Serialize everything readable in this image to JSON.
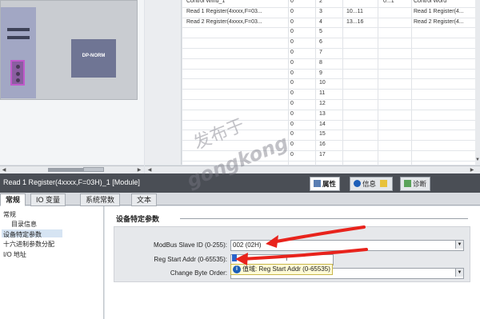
{
  "device": {
    "module_label": "DP-NORM"
  },
  "table": {
    "rows": [
      {
        "c1": "Control Wind_1",
        "c2": "0",
        "c3": "2",
        "c4": "",
        "c5": "0...1",
        "c6": "Control Word"
      },
      {
        "c1": "Read 1 Register(4xxxx,F=03...",
        "c2": "0",
        "c3": "3",
        "c4": "10...11",
        "c5": "",
        "c6": "Read 1 Register(4..."
      },
      {
        "c1": "Read 2 Register(4xxxx,F=03...",
        "c2": "0",
        "c3": "4",
        "c4": "13...16",
        "c5": "",
        "c6": "Read 2 Register(4..."
      },
      {
        "c1": "",
        "c2": "0",
        "c3": "5",
        "c4": "",
        "c5": "",
        "c6": ""
      },
      {
        "c1": "",
        "c2": "0",
        "c3": "6",
        "c4": "",
        "c5": "",
        "c6": ""
      },
      {
        "c1": "",
        "c2": "0",
        "c3": "7",
        "c4": "",
        "c5": "",
        "c6": ""
      },
      {
        "c1": "",
        "c2": "0",
        "c3": "8",
        "c4": "",
        "c5": "",
        "c6": ""
      },
      {
        "c1": "",
        "c2": "0",
        "c3": "9",
        "c4": "",
        "c5": "",
        "c6": ""
      },
      {
        "c1": "",
        "c2": "0",
        "c3": "10",
        "c4": "",
        "c5": "",
        "c6": ""
      },
      {
        "c1": "",
        "c2": "0",
        "c3": "11",
        "c4": "",
        "c5": "",
        "c6": ""
      },
      {
        "c1": "",
        "c2": "0",
        "c3": "12",
        "c4": "",
        "c5": "",
        "c6": ""
      },
      {
        "c1": "",
        "c2": "0",
        "c3": "13",
        "c4": "",
        "c5": "",
        "c6": ""
      },
      {
        "c1": "",
        "c2": "0",
        "c3": "14",
        "c4": "",
        "c5": "",
        "c6": ""
      },
      {
        "c1": "",
        "c2": "0",
        "c3": "15",
        "c4": "",
        "c5": "",
        "c6": ""
      },
      {
        "c1": "",
        "c2": "0",
        "c3": "16",
        "c4": "",
        "c5": "",
        "c6": ""
      },
      {
        "c1": "",
        "c2": "0",
        "c3": "17",
        "c4": "",
        "c5": "",
        "c6": ""
      }
    ]
  },
  "inspector": {
    "module_title": "Read 1 Register(4xxxx,F=03H)_1 [Module]",
    "tabs": {
      "properties": "属性",
      "info": "信息",
      "diagnostics": "诊断"
    }
  },
  "subtabs": {
    "general": "常规",
    "io_vars": "IO 变量",
    "sys_const": "系统常数",
    "text": "文本"
  },
  "nav": {
    "general": "常规",
    "catalog_info": "目录信息",
    "device_params": "设备特定参数",
    "hex_params": "十六进制参数分配",
    "io_address": "I/O 地址"
  },
  "params": {
    "section_title": "设备特定参数",
    "slave_id_label": "ModBus Slave ID (0-255):",
    "slave_id_value": "002 (02H)",
    "reg_start_label": "Reg Start Addr (0-65535):",
    "reg_start_value": "",
    "byte_order_label": "Change Byte Order:",
    "byte_order_value": "",
    "tooltip_prefix": "值域:",
    "tooltip_text": "Reg Start Addr (0-65535)"
  },
  "watermark": {
    "cn": "发布于",
    "en": "gongkong"
  },
  "colors": {
    "accent_red": "#e8231c",
    "selection": "#d6e4f3",
    "header_dark": "#4a4e55"
  }
}
